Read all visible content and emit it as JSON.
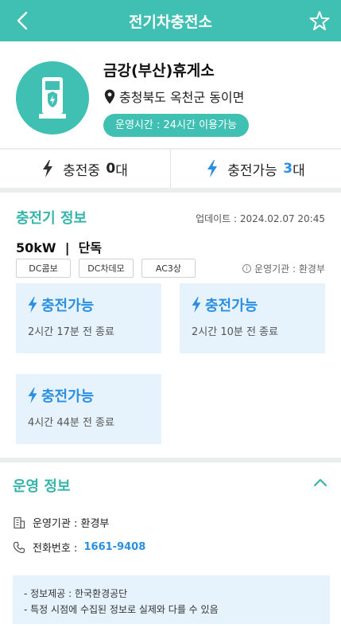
{
  "header": {
    "title": "전기차충전소",
    "back_icon": "chevron-left-icon",
    "favorite_icon": "star-outline-icon"
  },
  "station": {
    "name": "금강(부산)휴게소",
    "address": "충청북도 옥천군 동이면",
    "hours": "운영시간 : 24시간 이용가능",
    "logo_icon": "ev-charger-icon"
  },
  "status": {
    "charging_label": "충전중",
    "charging_count": "0",
    "charging_unit": "대",
    "available_label": "충전가능",
    "available_count": "3",
    "available_unit": "대"
  },
  "charger_info": {
    "title": "충전기 정보",
    "updated": "업데이트 : 2024.02.07 20:45",
    "spec": "50kW  |  단독",
    "connectors": [
      "DC콤보",
      "DC차데모",
      "AC3상"
    ],
    "operator": "운영기관 : 환경부",
    "chargers": [
      {
        "status": "충전가능",
        "detail": "2시간 17분 전 종료"
      },
      {
        "status": "충전가능",
        "detail": "2시간 10분 전 종료"
      },
      {
        "status": "충전가능",
        "detail": "4시간 44분 전 종료"
      }
    ]
  },
  "operation_info": {
    "title": "운영 정보",
    "operator_label": "운영기관 : ",
    "operator_value": "환경부",
    "phone_label": "전화번호 : ",
    "phone_value": "1661-9408",
    "notices": [
      "- 정보제공 : 한국환경공단",
      "- 특정 시점에 수집된 정보로 실제와 다를 수 있음"
    ]
  },
  "colors": {
    "brand": "#40bfb3",
    "accent_blue": "#2a8fe0",
    "card_bg": "#e6f3fc"
  }
}
